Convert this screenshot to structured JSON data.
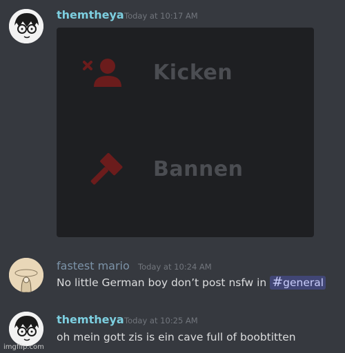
{
  "messages": [
    {
      "username": "themtheya",
      "timestamp": "Today at 10:17 AM",
      "embed": {
        "items": [
          {
            "icon": "kick-user-icon",
            "label": "Kicken"
          },
          {
            "icon": "ban-hammer-icon",
            "label": "Bannen"
          }
        ]
      }
    },
    {
      "username": "fastest mario",
      "timestamp": "Today at 10:24 AM",
      "text": "No little German boy don’t post nsfw in",
      "mention": {
        "hash": "#",
        "channel": "general"
      }
    },
    {
      "username": "themtheya",
      "timestamp": "Today at 10:25 AM",
      "text": "oh mein gott zis is ein cave full of boobtitten"
    }
  ],
  "watermark": "imgflip.com",
  "colors": {
    "background": "#36393f",
    "embed_background": "#1e1f22",
    "icon_red": "#6b1c1c",
    "username_teal": "#7dcfe0",
    "mention_bg": "#414675"
  }
}
